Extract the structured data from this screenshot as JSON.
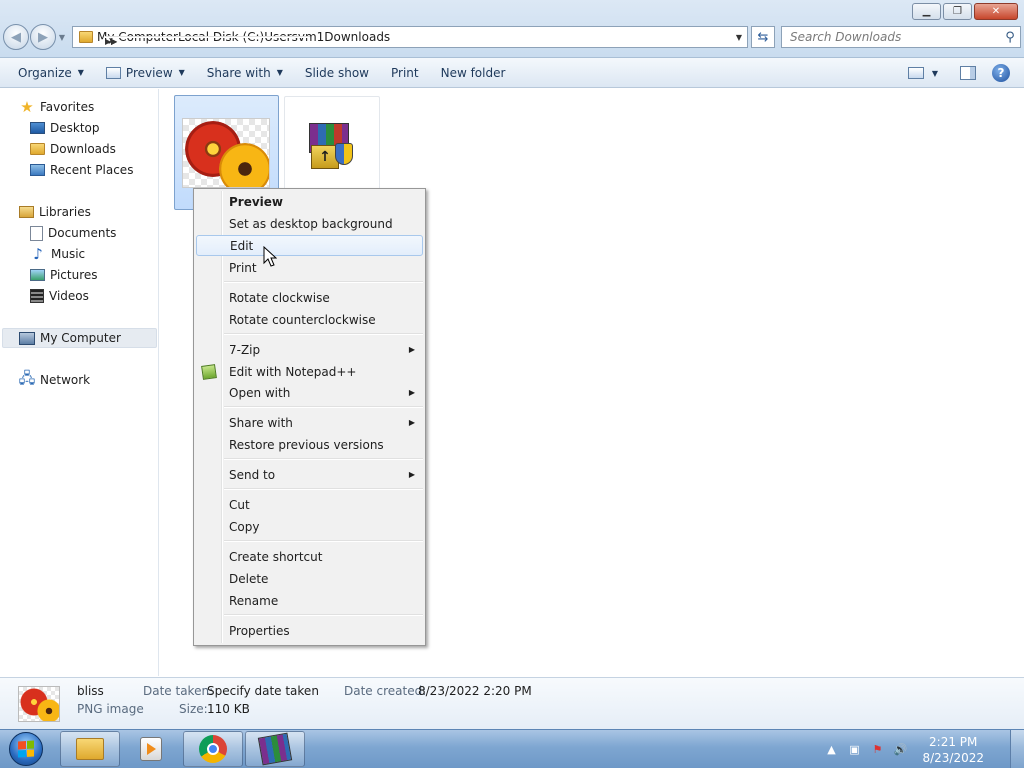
{
  "window": {
    "min_glyph": "▁",
    "restore_glyph": "❐",
    "close_glyph": "✕"
  },
  "address_bar": {
    "crumbs": [
      "My Computer",
      "Local Disk (C:)",
      "Users",
      "vm1",
      "Downloads"
    ]
  },
  "search": {
    "placeholder": "Search Downloads"
  },
  "toolbar": {
    "organize": "Organize",
    "preview": "Preview",
    "share_with": "Share with",
    "slide_show": "Slide show",
    "print": "Print",
    "new_folder": "New folder",
    "help": "?"
  },
  "sidebar": {
    "favorites": "Favorites",
    "desktop": "Desktop",
    "downloads": "Downloads",
    "recent_places": "Recent Places",
    "libraries": "Libraries",
    "documents": "Documents",
    "music": "Music",
    "pictures": "Pictures",
    "videos": "Videos",
    "my_computer": "My Computer",
    "network": "Network"
  },
  "files": [
    {
      "name": "bliss",
      "icon": "image-thumbnail-icon",
      "selected": true
    },
    {
      "name": "",
      "icon": "winrar-installer-icon",
      "selected": false
    }
  ],
  "context_menu": {
    "preview": "Preview",
    "set_desktop_bg": "Set as desktop background",
    "edit": "Edit",
    "print": "Print",
    "rotate_cw": "Rotate clockwise",
    "rotate_ccw": "Rotate counterclockwise",
    "seven_zip": "7-Zip",
    "edit_notepadpp": "Edit with Notepad++",
    "open_with": "Open with",
    "share_with": "Share with",
    "restore_versions": "Restore previous versions",
    "send_to": "Send to",
    "cut": "Cut",
    "copy": "Copy",
    "create_shortcut": "Create shortcut",
    "delete": "Delete",
    "rename": "Rename",
    "properties": "Properties",
    "highlighted": "Edit"
  },
  "details": {
    "name": "bliss",
    "type": "PNG image",
    "date_taken_label": "Date taken:",
    "date_taken_value": "Specify date taken",
    "size_label": "Size:",
    "size_value": "110 KB",
    "date_created_label": "Date created:",
    "date_created_value": "8/23/2022 2:20 PM"
  },
  "taskbar": {
    "time": "2:21 PM",
    "date": "8/23/2022",
    "apps": [
      "windows-explorer-icon",
      "media-player-icon",
      "chrome-icon",
      "winrar-icon"
    ]
  },
  "colors": {
    "accent": "#3c79c0",
    "selection": "#c1dbfc",
    "taskbar": "#7ea6d1"
  }
}
